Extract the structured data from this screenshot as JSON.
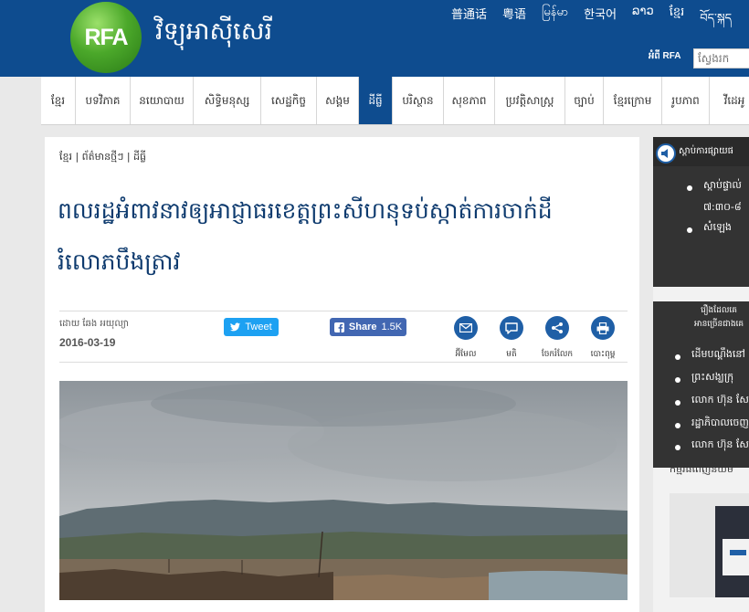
{
  "header": {
    "logo_text": "RFA",
    "site_title": "វិទ្យុអាស៊ីសេរី",
    "languages": [
      "普通话",
      "粤语",
      "မြန်မာ",
      "한국어",
      "ລາວ",
      "ខ្មែរ",
      "བོད་སྐད"
    ],
    "about_link": "អំពី RFA",
    "search_placeholder": "ស្វែងរក"
  },
  "nav": {
    "items": [
      "ខ្មែរ",
      "បទវិភាគ",
      "នយោបាយ",
      "សិទ្ធិមនុស្ស",
      "សេដ្ឋកិច្ច",
      "សង្គម",
      "ដីធ្លី",
      "បរិស្ថាន",
      "សុខភាព",
      "ប្រវត្តិសាស្ត្រ",
      "ច្បាប់",
      "ខ្មែរក្រោម",
      "រូបភាព",
      "វីដេអូ"
    ],
    "active_index": 6
  },
  "article": {
    "breadcrumb": "ខ្មែរ | ព័ត៌មានថ្មីៗ | ដីធ្លី",
    "title": "ពលរដ្ឋអំពាវនាវឲ្យអាជ្ញាធរខេត្តព្រះសីហនុទប់ស្កាត់ការចាក់ដីរំលោភបឹងត្រាវ",
    "byline": "ដោយ ឆែង អយុល្យា",
    "date": "2016-03-19",
    "tweet_label": "Tweet",
    "share_label": "Share",
    "share_count": "1.5K",
    "tools": [
      "អ៊ីមែល",
      "មតិ",
      "ចែករំលែក",
      "បោះពុម្ព"
    ]
  },
  "sidebar": {
    "listen_title": "ស្ដាប់ការផ្សាយផ",
    "listen_items": [
      "ស្ដាប់ផ្ទាល់",
      "៧:៣០-៨",
      "សំឡេង"
    ],
    "related_title_line1": "រឿងដែលគេ",
    "related_title_line2": "អានច្រើនជាងគេ",
    "related_items": [
      "ដើមបណ្ដឹងនៅ",
      "ព្រះសង្ឃក្រុ",
      "លោក ហ៊ុន សែ",
      "រដ្ឋាភិបាលចេញ",
      "លោក ហ៊ុន សែ"
    ],
    "promo_title": "កម្មវិធីពេញនិយម"
  },
  "colors": {
    "brand_blue": "#0e4c8f",
    "title_blue": "#0d3a6e",
    "twitter": "#1da1f2",
    "facebook": "#4267b2"
  }
}
